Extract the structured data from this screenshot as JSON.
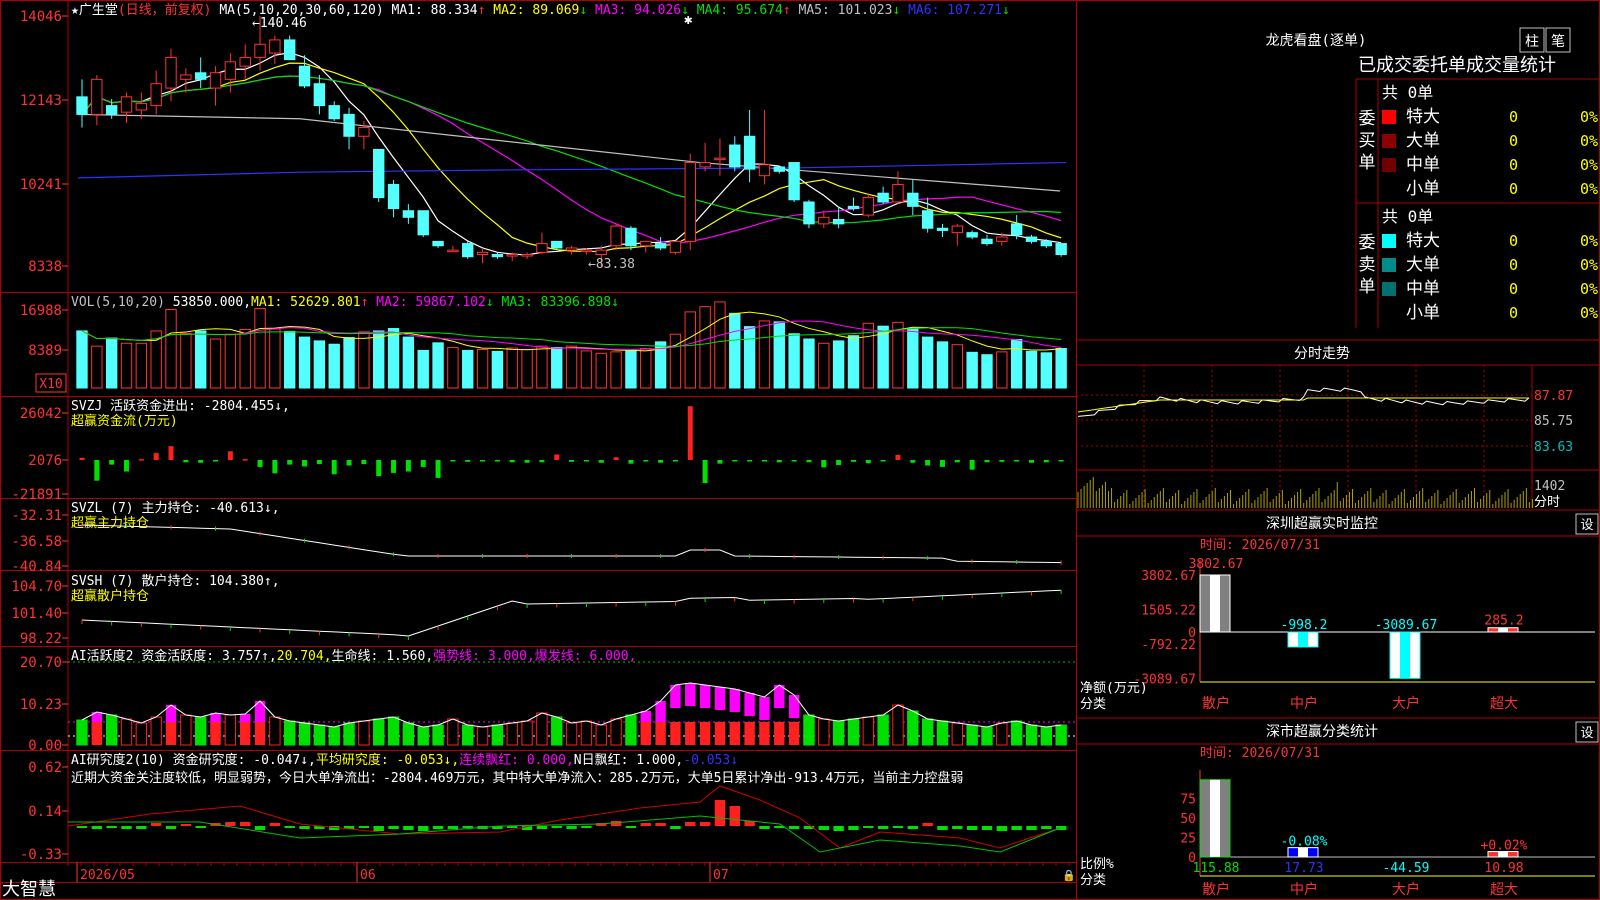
{
  "window": {
    "watermark_label": "大智慧",
    "lock_icon": "lock-icon"
  },
  "colors": {
    "up": "#ff3232",
    "down": "#54ffff",
    "grid": "#b00000",
    "ma1": "#ffffff",
    "ma2": "#ffff00",
    "ma3": "#ff00ff",
    "ma4": "#00e000",
    "ma5": "#c0c0c0",
    "ma6": "#3030ff",
    "text": "#c0c0c0"
  },
  "price_panel": {
    "title_star": "★",
    "stock_name": "广生堂",
    "period_note": "(日线，前复权)",
    "ma_spec": "MA(5,10,20,30,60,120)",
    "ma_values": [
      {
        "label": "MA1:",
        "value": "88.334",
        "arrow": "↑",
        "color": "#ffffff"
      },
      {
        "label": "MA2:",
        "value": "89.069",
        "arrow": "↓",
        "color": "#ffff00"
      },
      {
        "label": "MA3:",
        "value": "94.026",
        "arrow": "↓",
        "color": "#ff00ff"
      },
      {
        "label": "MA4:",
        "value": "95.674",
        "arrow": "↑",
        "color": "#00e000"
      },
      {
        "label": "MA5:",
        "value": "101.023",
        "arrow": "↓",
        "color": "#c0c0c0"
      },
      {
        "label": "MA6:",
        "value": "107.271",
        "arrow": "↓",
        "color": "#3030ff"
      }
    ],
    "y_ticks": [
      "14046",
      "12143",
      "10241",
      "8338"
    ],
    "high_marker": "140.46",
    "low_marker": "83.38"
  },
  "volume_panel": {
    "title": "VOL(5,10,20)",
    "current": "53850.000",
    "ma_values": [
      {
        "label": "MA1:",
        "value": "52629.801",
        "arrow": "↑",
        "color": "#ffff00"
      },
      {
        "label": "MA2:",
        "value": "59867.102",
        "arrow": "↓",
        "color": "#ff00ff"
      },
      {
        "label": "MA3:",
        "value": "83396.898",
        "arrow": "↓",
        "color": "#00e000"
      }
    ],
    "y_ticks": [
      "16988",
      "8389"
    ],
    "unit_label": "X10"
  },
  "svzj_panel": {
    "title": "SVZJ  活跃资金进出: -2804.455↓,",
    "subtitle": "超赢资金流(万元)",
    "y_ticks": [
      "26042",
      "2076",
      "-21891"
    ]
  },
  "svzl_panel": {
    "title": "SVZL (7) 主力持仓: -40.613↓,",
    "subtitle": "超赢主力持仓",
    "y_ticks": [
      "-32.31",
      "-36.58",
      "-40.84"
    ]
  },
  "svsh_panel": {
    "title": "SVSH (7) 散户持仓: 104.380↑,",
    "subtitle": "超赢散户持仓",
    "y_ticks": [
      "104.70",
      "101.40",
      "98.22"
    ]
  },
  "ai1_panel": {
    "title": "AI活跃度2 资金活跃度: 3.757↑,",
    "values": [
      {
        "text": "20.704,",
        "color": "#ffff00"
      },
      {
        "text": "生命线: 1.560,",
        "color": "#ffffff"
      },
      {
        "text": "强势线: 3.000,",
        "color": "#ff00ff"
      },
      {
        "text": "爆发线: 6.000,",
        "color": "#ff00ff"
      }
    ],
    "y_ticks": [
      "20.70",
      "10.23",
      "0.00"
    ]
  },
  "ai2_panel": {
    "title": "AI研究度2(10) 资金研究度: -0.047↓,",
    "values": [
      {
        "text": "平均研究度: -0.053↓,",
        "color": "#ffff00"
      },
      {
        "text": "连续飘红: 0.000,",
        "color": "#ff00ff"
      },
      {
        "text": "N日飘红: 1.000,",
        "color": "#ffffff"
      },
      {
        "text": "-0.053↓",
        "color": "#3030ff"
      }
    ],
    "comment": "近期大资金关注度较低，明显弱势，今日大单净流出：-2804.469万元，其中特大单净流入：285.2万元，大单5日累计净出-913.4万元，当前主力控盘弱",
    "y_ticks": [
      "0.62",
      "0.14",
      "-0.33"
    ]
  },
  "x_axis": {
    "labels": [
      "2026/05",
      "06",
      "07"
    ]
  },
  "dragon_tiger": {
    "title": "龙虎看盘(逐单)",
    "buttons": [
      "柱",
      "笔"
    ],
    "subtitle": "已成交委托单成交量统计",
    "buy": {
      "side_label": "委买单",
      "total": "共 0单",
      "rows": [
        {
          "name": "特大",
          "count": "0",
          "pct": "0%",
          "color": "#ff0000"
        },
        {
          "name": "大单",
          "count": "0",
          "pct": "0%",
          "color": "#8b0000"
        },
        {
          "name": "中单",
          "count": "0",
          "pct": "0%",
          "color": "#700000"
        },
        {
          "name": "小单",
          "count": "0",
          "pct": "0%",
          "color": "#000000"
        }
      ]
    },
    "sell": {
      "side_label": "委卖单",
      "total": "共 0单",
      "rows": [
        {
          "name": "特大",
          "count": "0",
          "pct": "0%",
          "color": "#00ffff"
        },
        {
          "name": "大单",
          "count": "0",
          "pct": "0%",
          "color": "#008b8b"
        },
        {
          "name": "中单",
          "count": "0",
          "pct": "0%",
          "color": "#007070"
        },
        {
          "name": "小单",
          "count": "0",
          "pct": "0%",
          "color": "#000000"
        }
      ]
    }
  },
  "intraday": {
    "title": "分时走势",
    "y_ticks": [
      "87.87",
      "85.75",
      "83.63"
    ],
    "vol_tick": "1402",
    "vol_unit": "分时"
  },
  "realtime_monitor": {
    "title": "深圳超赢实时监控",
    "setting": "设",
    "time": "时间: 2026/07/31",
    "y_ticks": [
      "3802.67",
      "1505.22",
      "0",
      "-792.22",
      "-3089.67"
    ],
    "axis_title": "净额(万元)",
    "axis_cat": "分类",
    "categories": [
      "散户",
      "中户",
      "大户",
      "超大"
    ],
    "values": [
      3802.67,
      -998.2,
      -3089.67,
      285.2
    ],
    "value_labels": [
      "3802.67",
      "-998.2",
      "-3089.67",
      "285.2"
    ]
  },
  "class_stats": {
    "title": "深市超赢分类统计",
    "setting": "设",
    "time": "时间: 2026/07/31",
    "y_ticks": [
      "75",
      "50",
      "25",
      "0"
    ],
    "axis_title": "比例%",
    "axis_cat": "分类",
    "categories": [
      "散户",
      "中户",
      "大户",
      "超大"
    ],
    "pct_labels": [
      "",
      "-0.08%",
      "",
      "+0.02%"
    ],
    "bottom_values": [
      "115.88",
      "17.73",
      "-44.59",
      "10.98"
    ]
  },
  "chart_data": [
    {
      "type": "candlestick",
      "title": "广生堂",
      "ylim": [
        83.38,
        140.46
      ],
      "ohlc": [
        [
          122.0,
          126.0,
          115.0,
          118.0
        ],
        [
          118.0,
          127.0,
          115.5,
          126.0
        ],
        [
          120.0,
          121.5,
          117.0,
          118.0
        ],
        [
          118.5,
          123.0,
          116.0,
          122.0
        ],
        [
          119.0,
          123.0,
          117.0,
          120.5
        ],
        [
          120.0,
          128.0,
          118.0,
          125.0
        ],
        [
          124.0,
          133.0,
          121.0,
          131.0
        ],
        [
          126.0,
          128.5,
          123.0,
          127.0
        ],
        [
          127.5,
          131.0,
          124.0,
          126.0
        ],
        [
          124.0,
          129.0,
          120.0,
          127.5
        ],
        [
          126.0,
          132.0,
          123.0,
          130.0
        ],
        [
          129.0,
          134.0,
          126.0,
          131.0
        ],
        [
          131.0,
          140.46,
          128.0,
          134.0
        ],
        [
          132.0,
          136.0,
          129.5,
          135.0
        ],
        [
          135.0,
          136.0,
          130.5,
          130.5
        ],
        [
          129.0,
          131.5,
          124.0,
          124.5
        ],
        [
          125.0,
          127.0,
          118.0,
          120.0
        ],
        [
          120.0,
          121.0,
          116.5,
          117.0
        ],
        [
          118.0,
          119.5,
          110.0,
          113.0
        ],
        [
          113.0,
          116.5,
          110.0,
          115.0
        ],
        [
          110.0,
          110.0,
          98.0,
          99.0
        ],
        [
          102.0,
          103.0,
          94.5,
          96.5
        ],
        [
          96.0,
          97.5,
          93.0,
          94.5
        ],
        [
          96.0,
          96.0,
          90.0,
          90.5
        ],
        [
          89.0,
          89.0,
          87.5,
          88.0
        ],
        [
          87.0,
          88.0,
          87.0,
          87.0
        ],
        [
          88.5,
          89.0,
          85.0,
          85.5
        ],
        [
          86.0,
          87.5,
          84.0,
          86.5
        ],
        [
          86.0,
          86.5,
          85.0,
          85.5
        ],
        [
          86.0,
          86.5,
          84.5,
          86.0
        ],
        [
          86.0,
          86.5,
          85.0,
          86.0
        ],
        [
          86.5,
          91.0,
          86.0,
          88.5
        ],
        [
          89.0,
          89.0,
          87.0,
          87.5
        ],
        [
          87.0,
          88.0,
          86.0,
          87.5
        ],
        [
          87.0,
          87.5,
          86.0,
          87.0
        ],
        [
          86.0,
          88.0,
          83.38,
          87.0
        ],
        [
          88.0,
          93.0,
          87.0,
          92.5
        ],
        [
          92.0,
          92.5,
          87.0,
          88.0
        ],
        [
          88.0,
          89.0,
          86.5,
          89.0
        ],
        [
          88.5,
          90.0,
          87.0,
          87.5
        ],
        [
          86.5,
          89.0,
          86.0,
          89.0
        ],
        [
          89.0,
          109.0,
          87.0,
          107.0
        ],
        [
          106.0,
          111.5,
          105.0,
          107.0
        ],
        [
          108.0,
          112.5,
          104.0,
          108.0
        ],
        [
          111.0,
          113.0,
          105.0,
          106.0
        ],
        [
          113.0,
          119.0,
          102.5,
          105.5
        ],
        [
          104.0,
          119.0,
          102.0,
          106.5
        ],
        [
          106.0,
          106.0,
          104.5,
          105.0
        ],
        [
          107.0,
          107.0,
          98.0,
          98.5
        ],
        [
          98.0,
          98.5,
          92.0,
          93.0
        ],
        [
          93.0,
          96.0,
          92.0,
          94.5
        ],
        [
          94.0,
          97.0,
          92.0,
          93.0
        ],
        [
          97.0,
          99.0,
          96.0,
          96.5
        ],
        [
          95.0,
          100.0,
          94.5,
          99.0
        ],
        [
          100.0,
          101.5,
          97.5,
          98.0
        ],
        [
          98.0,
          105.0,
          97.5,
          102.0
        ],
        [
          100.0,
          103.0,
          95.0,
          97.0
        ],
        [
          96.0,
          99.0,
          91.0,
          92.0
        ],
        [
          92.0,
          93.0,
          90.0,
          91.5
        ],
        [
          91.0,
          93.0,
          88.0,
          92.5
        ],
        [
          91.0,
          91.5,
          89.5,
          90.0
        ],
        [
          89.5,
          90.5,
          88.0,
          88.5
        ],
        [
          89.0,
          91.0,
          88.0,
          90.0
        ],
        [
          93.0,
          95.0,
          89.5,
          90.5
        ],
        [
          90.0,
          90.5,
          88.5,
          89.0
        ],
        [
          89.0,
          89.5,
          87.5,
          88.0
        ],
        [
          88.5,
          88.5,
          85.5,
          86.0
        ]
      ]
    },
    {
      "type": "bar",
      "title": "VOL(5,10,20)",
      "unit": "X10",
      "values": [
        12000,
        8800,
        10500,
        9400,
        9400,
        12000,
        16500,
        11500,
        12000,
        10300,
        11300,
        12300,
        16700,
        12400,
        11900,
        10700,
        9900,
        9200,
        10600,
        11800,
        12000,
        12500,
        10700,
        7900,
        9500,
        8500,
        7900,
        8100,
        7700,
        8400,
        8100,
        8800,
        8500,
        8800,
        7800,
        7300,
        7600,
        8000,
        8300,
        9700,
        11300,
        16000,
        17100,
        18100,
        15700,
        12900,
        14100,
        13900,
        11400,
        10300,
        9400,
        9900,
        11000,
        13600,
        13000,
        13800,
        12500,
        10700,
        9700,
        9100,
        7500,
        7000,
        7600,
        10200,
        7700,
        7400,
        8300
      ]
    },
    {
      "type": "bar",
      "title": "SVZJ",
      "unit": "万元",
      "values": [
        500,
        -4500,
        -1000,
        -2500,
        200,
        1500,
        3000,
        -500,
        -600,
        -300,
        1900,
        200,
        -1500,
        -2900,
        -1000,
        -1400,
        -900,
        -3100,
        -1200,
        -900,
        -3500,
        -2800,
        -2500,
        -1500,
        -3900,
        -200,
        -400,
        -300,
        -300,
        -500,
        -600,
        -500,
        1200,
        -400,
        -200,
        -600,
        600,
        -800,
        -300,
        -600,
        -300,
        11700,
        -5000,
        -800,
        -300,
        -300,
        -100,
        -500,
        -300,
        -500,
        -1600,
        -1100,
        -400,
        -700,
        -300,
        1100,
        -600,
        -1200,
        -1500,
        -500,
        -2100,
        -500,
        -400,
        -200,
        -600,
        -500,
        -200,
        -200,
        -600,
        -200,
        -500
      ]
    },
    {
      "type": "line",
      "title": "SVZL",
      "ylim": [
        -40.84,
        -32.31
      ]
    },
    {
      "type": "line",
      "title": "SVSH",
      "ylim": [
        98.22,
        104.7
      ]
    },
    {
      "type": "bar",
      "title": "AI活跃度2",
      "ylim": [
        0,
        20.7
      ]
    },
    {
      "type": "bar",
      "title": "AI研究度2",
      "ylim": [
        -0.33,
        0.62
      ]
    },
    {
      "type": "bar",
      "title": "深圳超赢实时监控",
      "categories": [
        "散户",
        "中户",
        "大户",
        "超大"
      ],
      "values": [
        3802.67,
        -998.2,
        -3089.67,
        285.2
      ]
    },
    {
      "type": "bar",
      "title": "深市超赢分类统计",
      "categories": [
        "散户",
        "中户",
        "大户",
        "超大"
      ],
      "values": [
        115.88,
        17.73,
        -44.59,
        10.98
      ]
    }
  ]
}
